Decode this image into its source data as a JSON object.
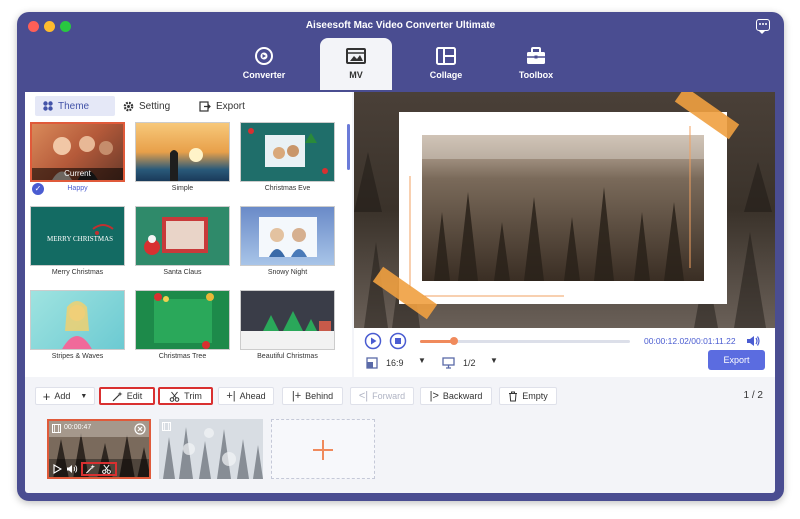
{
  "window": {
    "title": "Aiseesoft Mac Video Converter Ultimate"
  },
  "nav": {
    "tabs": [
      {
        "label": "Converter",
        "icon": "converter-icon"
      },
      {
        "label": "MV",
        "icon": "mv-icon",
        "active": true
      },
      {
        "label": "Collage",
        "icon": "collage-icon"
      },
      {
        "label": "Toolbox",
        "icon": "toolbox-icon"
      }
    ]
  },
  "subtabs": {
    "theme": "Theme",
    "setting": "Setting",
    "export": "Export"
  },
  "themes": [
    {
      "name": "Happy",
      "badge": "Current",
      "selected": true
    },
    {
      "name": "Simple"
    },
    {
      "name": "Christmas Eve"
    },
    {
      "name": "Merry Christmas"
    },
    {
      "name": "Santa Claus"
    },
    {
      "name": "Snowy Night"
    },
    {
      "name": "Stripes & Waves"
    },
    {
      "name": "Christmas Tree"
    },
    {
      "name": "Beautiful Christmas"
    }
  ],
  "thumb_art": {
    "merry_text": "MERRY CHRISTMAS"
  },
  "player": {
    "current_time": "00:00:12.02",
    "total_time": "/00:01:11.22",
    "progress": 0.16,
    "aspect": "16:9",
    "page": "1/2",
    "export_label": "Export"
  },
  "toolbar": {
    "add": "Add",
    "edit": "Edit",
    "trim": "Trim",
    "ahead": "Ahead",
    "behind": "Behind",
    "forward": "Forward",
    "backward": "Backward",
    "empty": "Empty",
    "page_count": "1 / 2"
  },
  "clips": [
    {
      "duration": "00:00:47",
      "selected": true
    },
    {
      "duration": ""
    }
  ],
  "colors": {
    "accent": "#5b6ce0",
    "window_bg": "#4a4d91",
    "highlight": "#e05a3a",
    "progress": "#f08a5c"
  }
}
